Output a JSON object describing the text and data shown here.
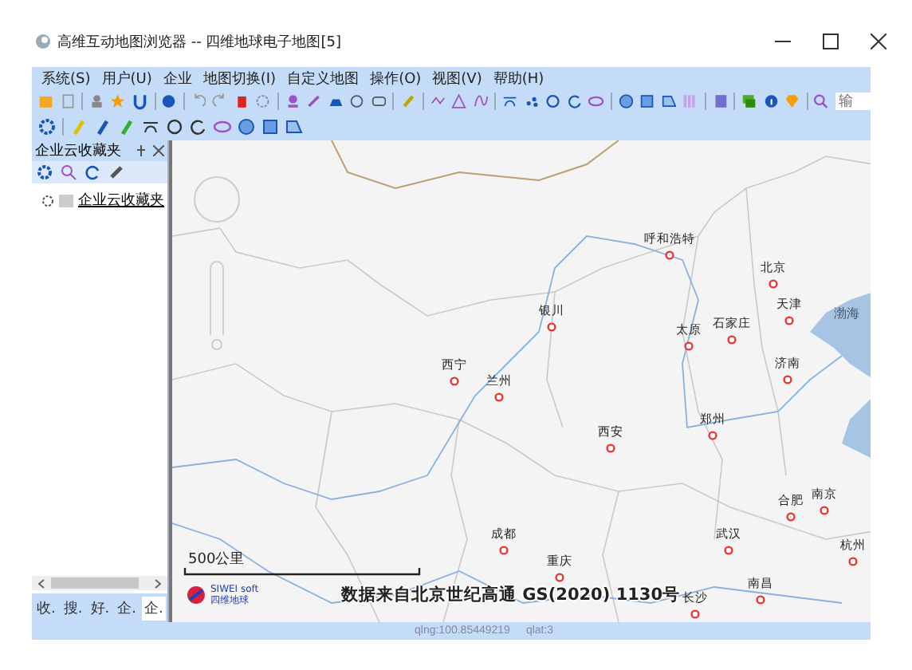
{
  "window": {
    "title": "高维互动地图浏览器 -- 四维地球电子地图[5]"
  },
  "menu": [
    "系统(S)",
    "用户(U)",
    "企业",
    "地图切换(I)",
    "自定义地图",
    "操作(O)",
    "视图(V)",
    "帮助(H)"
  ],
  "toolbar": {
    "search": {
      "placeholder": "输"
    }
  },
  "side_panel": {
    "title": "企业云收藏夹",
    "tree": [
      {
        "label": "企业云收藏夹"
      }
    ],
    "tabs": [
      {
        "label": "收.",
        "selected": false
      },
      {
        "label": "搜.",
        "selected": false
      },
      {
        "label": "好.",
        "selected": false
      },
      {
        "label": "企.",
        "selected": false
      },
      {
        "label": "企.",
        "selected": true
      }
    ]
  },
  "map": {
    "cities": [
      {
        "name": "呼和浩特"
      },
      {
        "name": "北京"
      },
      {
        "name": "天津"
      },
      {
        "name": "银川"
      },
      {
        "name": "太原"
      },
      {
        "name": "石家庄"
      },
      {
        "name": "西宁"
      },
      {
        "name": "兰州"
      },
      {
        "name": "济南"
      },
      {
        "name": "郑州"
      },
      {
        "name": "西安"
      },
      {
        "name": "合肥"
      },
      {
        "name": "南京"
      },
      {
        "name": "成都"
      },
      {
        "name": "武汉"
      },
      {
        "name": "杭州"
      },
      {
        "name": "重庆"
      },
      {
        "name": "长沙"
      },
      {
        "name": "南昌"
      }
    ],
    "sea": "渤海",
    "scale": "500公里",
    "copyright": "数据来自北京世纪高通 GS(2020) 1130号",
    "logo": {
      "text": "SIWEI soft",
      "subtext": "四维地球"
    }
  },
  "status_bar": [
    "qlng:100.85449219",
    "qlat:3"
  ]
}
